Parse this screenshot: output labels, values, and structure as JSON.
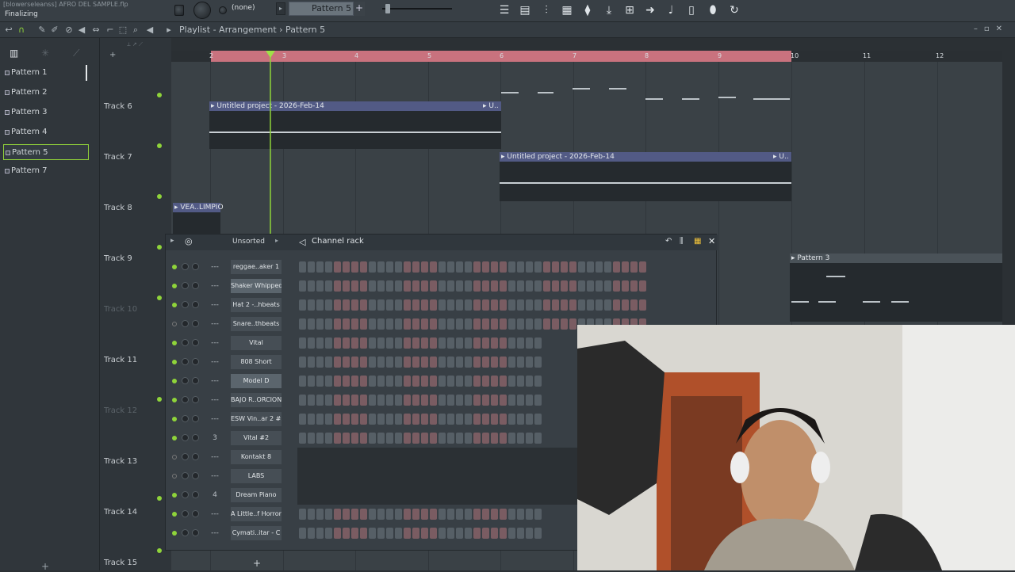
{
  "app": {
    "project_title": "[blowerseleanss] AFRO DEL SAMPLE.flp",
    "status": "Finalizing",
    "none_label": "(none)",
    "pattern_selector": "Pattern 5",
    "breadcrumb": "Playlist - Arrangement › Pattern 5"
  },
  "patterns": [
    "Pattern 1",
    "Pattern 2",
    "Pattern 3",
    "Pattern 4",
    "Pattern 5",
    "Pattern 7"
  ],
  "selected_pattern": "Pattern 5",
  "tracks": [
    "Track 6",
    "Track 7",
    "Track 8",
    "Track 9",
    "Track 10",
    "Track 11",
    "Track 12",
    "Track 13",
    "Track 14",
    "Track 15"
  ],
  "ruler": [
    "2",
    "3",
    "4",
    "5",
    "6",
    "7",
    "8",
    "9",
    "10",
    "11",
    "12"
  ],
  "clips": {
    "clip_a": "▸ Untitled project - 2026-Feb-14",
    "clip_a_end": "▸ U..",
    "clip_b": "▸ Untitled project - 2026-Feb-14",
    "clip_b_end": "▸ U..",
    "clip_c": "▸ VEA..LIMPIO",
    "clip_d": "▸ Pattern 3"
  },
  "channel_rack": {
    "title": "Channel rack",
    "filter": "Unsorted",
    "channels": [
      {
        "name": "reggae..aker 1",
        "mix": "---",
        "on": true
      },
      {
        "name": "Shaker Whipped",
        "mix": "---",
        "on": true
      },
      {
        "name": "Hat 2 -..hbeats",
        "mix": "---",
        "on": true
      },
      {
        "name": "Snare..thbeats",
        "mix": "---",
        "on": false
      },
      {
        "name": "Vital",
        "mix": "---",
        "on": true
      },
      {
        "name": "808 Short",
        "mix": "---",
        "on": true
      },
      {
        "name": "Model D",
        "mix": "---",
        "on": true
      },
      {
        "name": "BAJO R..ORCION",
        "mix": "---",
        "on": true
      },
      {
        "name": "ESW Vin..ar 2 #2",
        "mix": "---",
        "on": true
      },
      {
        "name": "Vital #2",
        "mix": "3",
        "on": true
      },
      {
        "name": "Kontakt 8",
        "mix": "---",
        "on": false
      },
      {
        "name": "LABS",
        "mix": "---",
        "on": false
      },
      {
        "name": "Dream Piano",
        "mix": "4",
        "on": true
      },
      {
        "name": "A Little..f Horror",
        "mix": "---",
        "on": true
      },
      {
        "name": "Cymati..itar - C",
        "mix": "---",
        "on": true
      }
    ]
  },
  "colors": {
    "accent_green": "#8fd43a",
    "loop_region": "#c9727e",
    "clip_header": "#525a85"
  }
}
